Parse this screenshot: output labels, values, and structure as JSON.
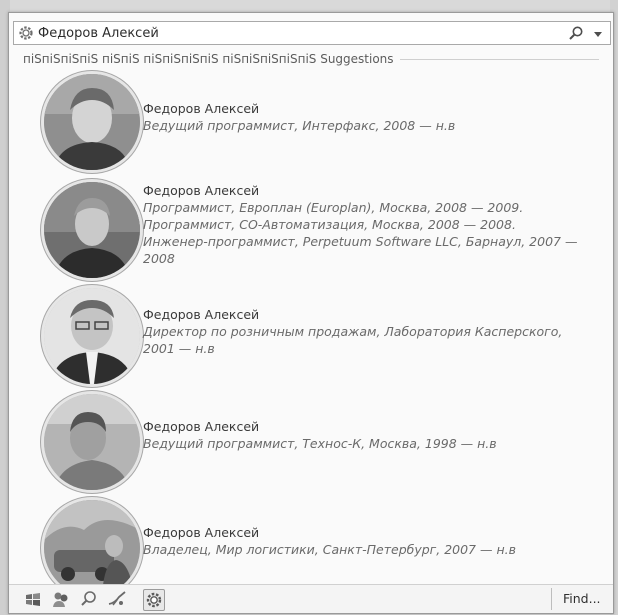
{
  "search": {
    "value": "Федоров Алексей",
    "placeholder": ""
  },
  "suggestions": {
    "section_title": "піЅпіЅпіЅпіЅ піЅпіЅ піЅпіЅпіЅпіЅ піЅпіЅпіЅпіЅпіЅ Suggestions",
    "items": [
      {
        "name": "Федоров Алексей",
        "desc": "Ведущий программист, Интерфакс, 2008 — н.в"
      },
      {
        "name": "Федоров Алексей",
        "desc": "Программист, Европлан (Europlan), Москва, 2008 — 2009. Программист, СО-Автоматизация, Москва, 2008 — 2008. Инженер-программист, Perpetuum Software LLC, Барнаул, 2007 — 2008"
      },
      {
        "name": "Федоров Алексей",
        "desc": "Директор по розничным продажам, Лаборатория Касперского, 2001 — н.в"
      },
      {
        "name": "Федоров Алексей",
        "desc": "Ведущий программист, Технос-К, Москва, 1998 — н.в"
      },
      {
        "name": "Федоров Алексей",
        "desc": "Владелец, Мир логистики, Санкт-Петербург, 2007 — н.в"
      }
    ]
  },
  "bottombar": {
    "find_label": "Find...",
    "icons": [
      "windows-icon",
      "people-icon",
      "search-globe-icon",
      "signal-icon",
      "settings-gear-icon"
    ]
  }
}
